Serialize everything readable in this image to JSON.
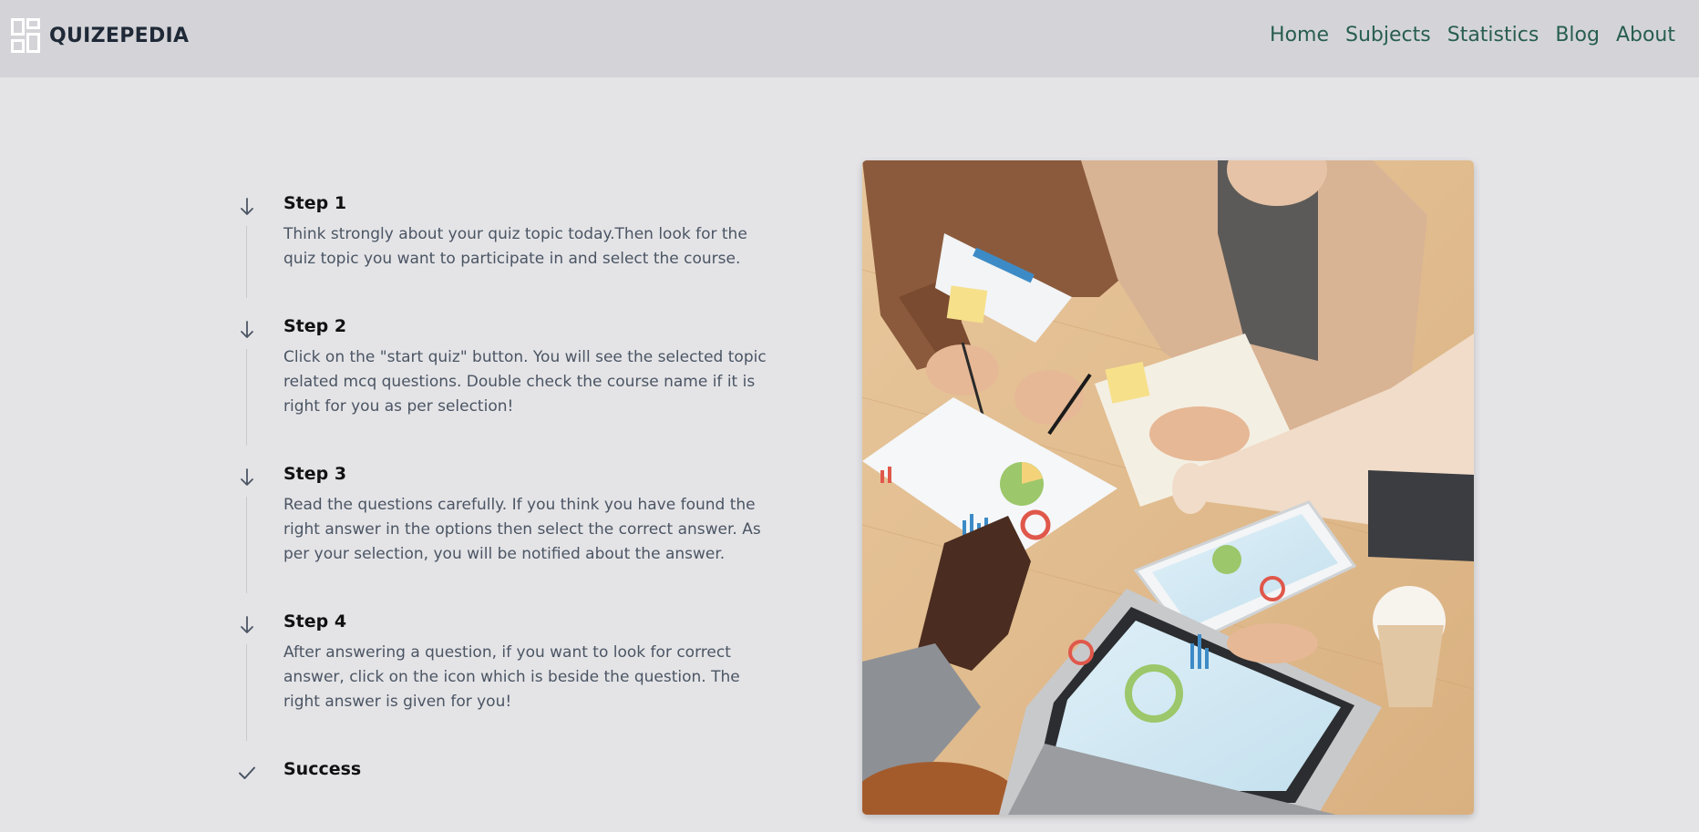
{
  "header": {
    "brand": "QUIZEPEDIA",
    "nav": [
      {
        "label": "Home"
      },
      {
        "label": "Subjects"
      },
      {
        "label": "Statistics"
      },
      {
        "label": "Blog"
      },
      {
        "label": "About"
      }
    ]
  },
  "steps": [
    {
      "title": "Step 1",
      "text": "Think strongly about your quiz topic today.Then look for the quiz topic you want to participate in and select the course.",
      "icon": "arrow-down-icon"
    },
    {
      "title": "Step 2",
      "text": "Click on the \"start quiz\" button. You will see the selected topic related mcq questions. Double check the course name if it is right for you as per selection!",
      "icon": "arrow-down-icon"
    },
    {
      "title": "Step 3",
      "text": "Read the questions carefully. If you think you have found the right answer in the options then select the correct answer. As per your selection, you will be notified about the answer.",
      "icon": "arrow-down-icon"
    },
    {
      "title": "Step 4",
      "text": "After answering a question, if you want to look for correct answer, click on the icon which is beside the question. The right answer is given for you!",
      "icon": "arrow-down-icon"
    },
    {
      "title": "Success",
      "icon": "check-icon"
    }
  ],
  "colors": {
    "page_bg": "#e4e4e7",
    "navbar_bg": "#d4d4d8",
    "nav_link": "#285e4e",
    "heading": "#111111",
    "body_text": "#4b5563"
  }
}
